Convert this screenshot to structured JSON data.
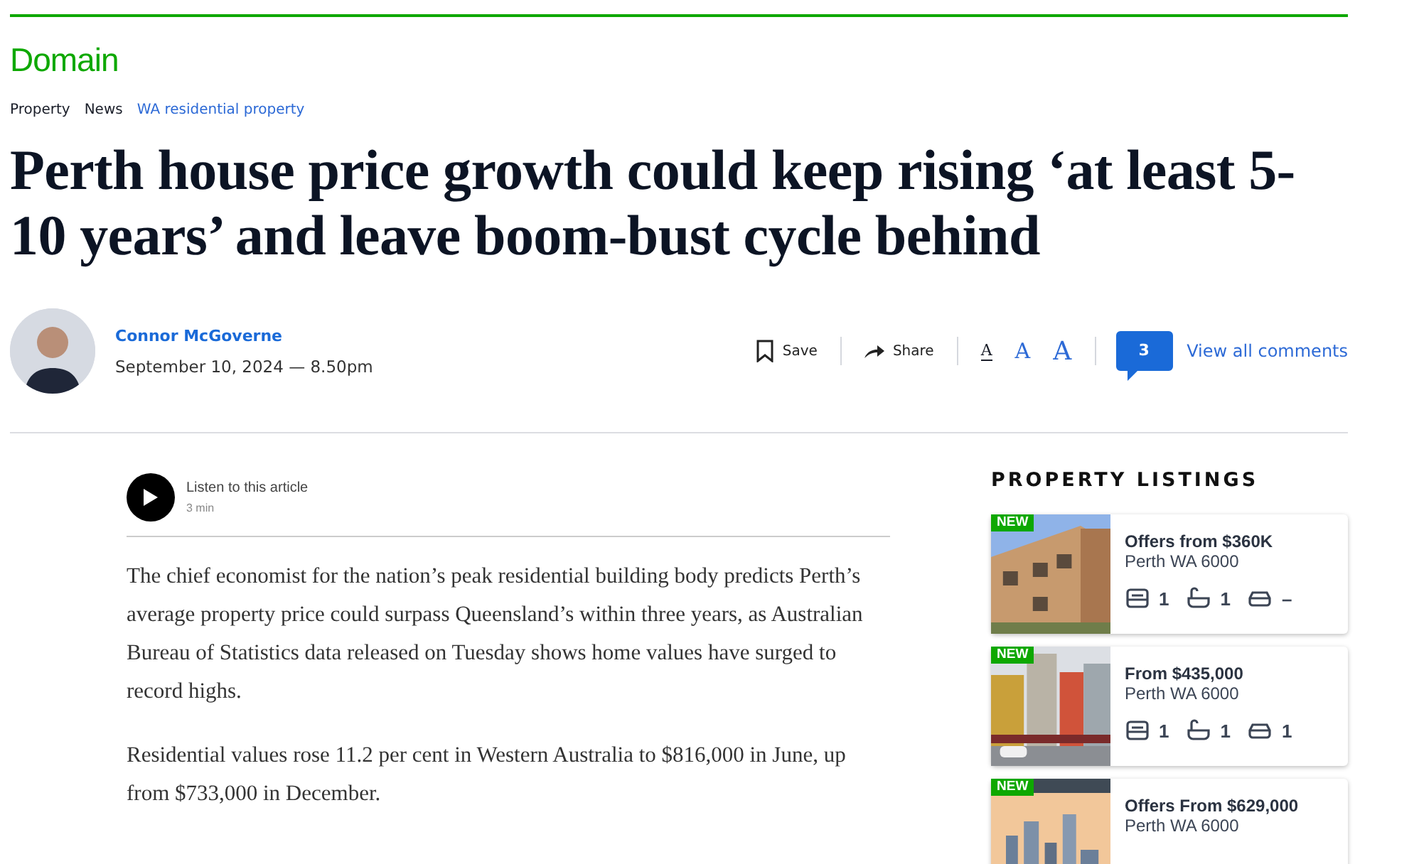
{
  "logo": "Domain",
  "breadcrumbs": [
    {
      "label": "Property",
      "kind": "plain"
    },
    {
      "label": "News",
      "kind": "plain"
    },
    {
      "label": "WA residential property",
      "kind": "link"
    }
  ],
  "headline": "Perth house price growth could keep rising ‘at least 5-10 years’ and leave boom-bust cycle behind",
  "author": {
    "name": "Connor McGoverne",
    "date": "September 10, 2024 — 8.50pm"
  },
  "actions": [
    {
      "label": "Save",
      "kind": "save"
    },
    {
      "label": "Share",
      "kind": "share"
    }
  ],
  "font_sizes": [
    {
      "label": "A",
      "selected": true
    },
    {
      "label": "A",
      "selected": false
    },
    {
      "label": "A",
      "selected": false
    }
  ],
  "comments": {
    "count": "3",
    "link": "View all comments"
  },
  "audio": {
    "title": "Listen to this article",
    "duration": "3 min"
  },
  "paragraphs": [
    "The chief economist for the nation’s peak residential building body predicts Perth’s average property price could surpass Queensland’s within three years, as Australian Bureau of Statistics data released on Tuesday shows home values have surged to record highs.",
    "Residential values rose 11.2 per cent in Western Australia to $816,000 in June, up from $733,000 in December."
  ],
  "listings_title": "PROPERTY LISTINGS",
  "listings": [
    {
      "badge": "NEW",
      "price": "Offers from $360K",
      "location": "Perth WA 6000",
      "beds": "1",
      "baths": "1",
      "cars": "–"
    },
    {
      "badge": "NEW",
      "price": "From $435,000",
      "location": "Perth WA 6000",
      "beds": "1",
      "baths": "1",
      "cars": "1"
    },
    {
      "badge": "NEW",
      "price": "Offers From $629,000",
      "location": "Perth WA 6000"
    }
  ]
}
